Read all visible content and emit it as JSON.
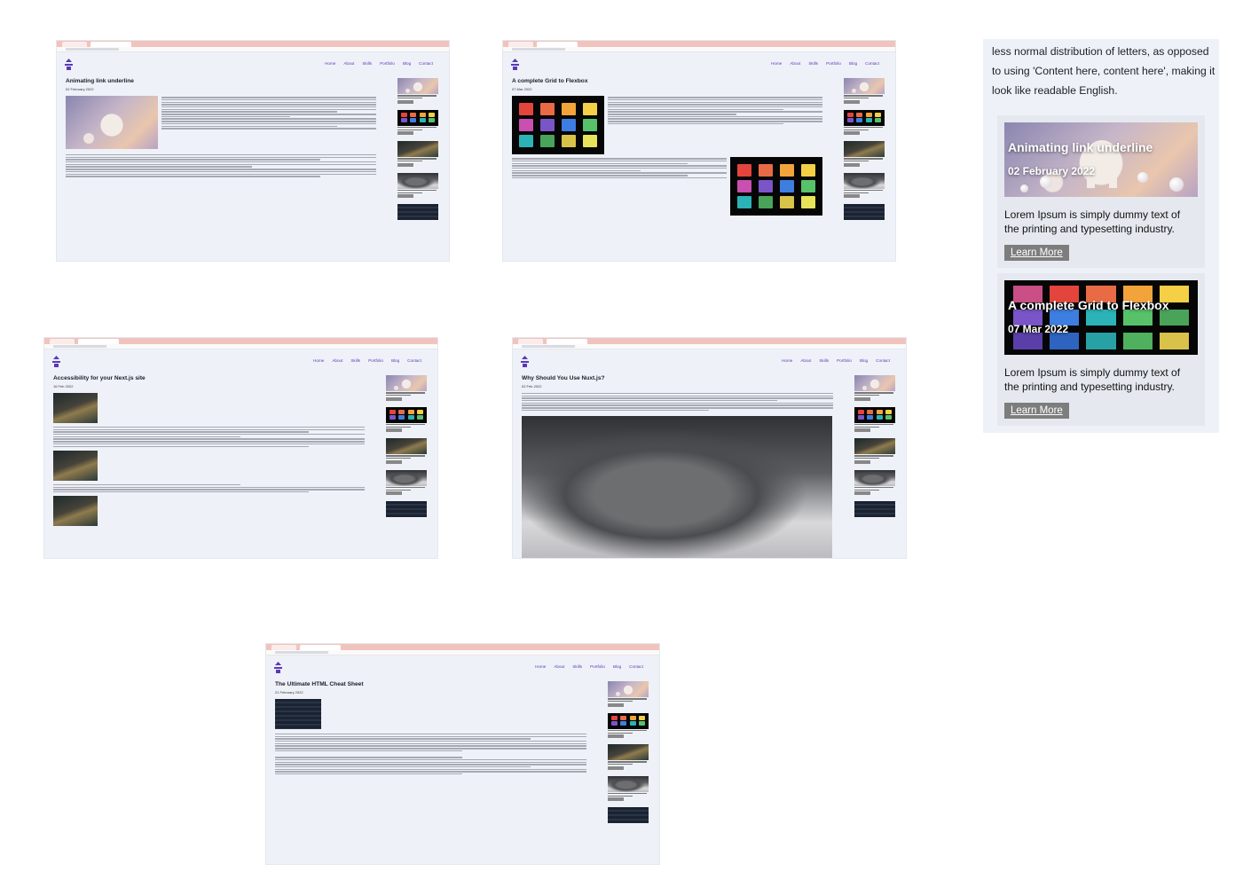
{
  "site": {
    "nav": [
      "Home",
      "About",
      "Skills",
      "Portfolio",
      "Blog",
      "Contact"
    ]
  },
  "screenshots": [
    {
      "title": "Animating link underline",
      "date": "02 February 2022"
    },
    {
      "title": "A complete Grid to Flexbox",
      "date": "07 Mar 2022"
    },
    {
      "title": "Accessibility for your Next.js site",
      "date": "16 Feb 2022"
    },
    {
      "title": "Why Should You Use Nuxt.js?",
      "date": "02 Feb 2022"
    },
    {
      "title": "The Ultimate HTML Cheat Sheet",
      "date": "21 February 2022"
    }
  ],
  "panel": {
    "intro": "less normal distribution of letters, as opposed to using 'Content here, content here', making it look like readable English.",
    "cards": [
      {
        "title": "Animating link underline",
        "date": "02 February 2022",
        "description": "Lorem Ipsum is simply dummy text of the printing and typesetting industry.",
        "button": "Learn More"
      },
      {
        "title": "A complete Grid to Flexbox",
        "date": "07 Mar 2022",
        "description": "Lorem Ipsum is simply dummy text of the printing and typesetting industry.",
        "button": "Learn More"
      }
    ]
  }
}
